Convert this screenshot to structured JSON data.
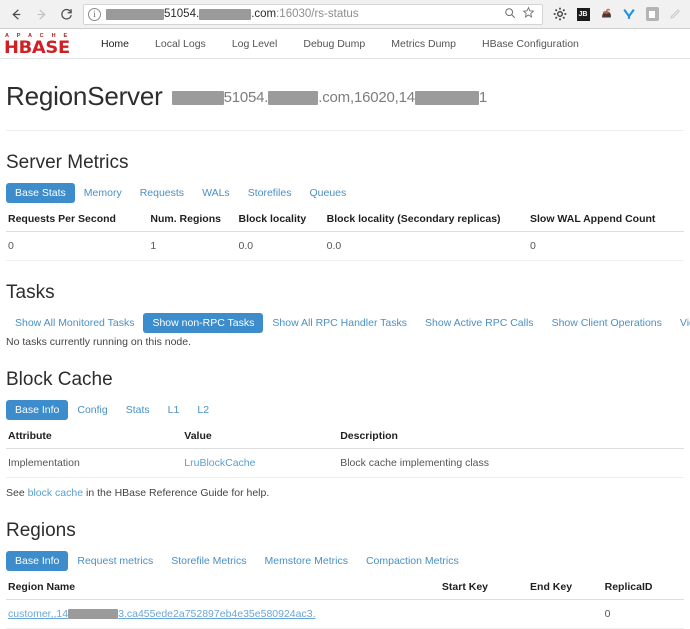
{
  "browser": {
    "back_icon": "back-arrow-icon",
    "forward_icon": "forward-arrow-icon",
    "reload_icon": "reload-icon",
    "url_prefix_redacted": true,
    "url_part1": "51054.",
    "url_part2": ".com",
    "url_part3": ":16030/rs-status",
    "search_icon": "search-icon",
    "bookmark_icon": "star-icon",
    "gear_icon": "gear-icon",
    "jetbrains_icon_label": "JB",
    "extension_icons": [
      "jetbrains-icon",
      "dark-blob-icon",
      "vimeo-y-icon",
      "grey-note-icon",
      "pen-icon"
    ]
  },
  "nav": {
    "logo_top": "A P A C H E",
    "logo_main": "HBASE",
    "links": [
      {
        "label": "Home",
        "active": true
      },
      {
        "label": "Local Logs",
        "active": false
      },
      {
        "label": "Log Level",
        "active": false
      },
      {
        "label": "Debug Dump",
        "active": false
      },
      {
        "label": "Metrics Dump",
        "active": false
      },
      {
        "label": "HBase Configuration",
        "active": false
      }
    ]
  },
  "page": {
    "title": "RegionServer",
    "server_part1": "51054.",
    "server_part2": ".com,16020,14",
    "server_part3": "1"
  },
  "server_metrics": {
    "heading": "Server Metrics",
    "tabs": [
      {
        "label": "Base Stats",
        "active": true
      },
      {
        "label": "Memory",
        "active": false
      },
      {
        "label": "Requests",
        "active": false
      },
      {
        "label": "WALs",
        "active": false
      },
      {
        "label": "Storefiles",
        "active": false
      },
      {
        "label": "Queues",
        "active": false
      }
    ],
    "columns": [
      "Requests Per Second",
      "Num. Regions",
      "Block locality",
      "Block locality (Secondary replicas)",
      "Slow WAL Append Count"
    ],
    "rows": [
      [
        "0",
        "1",
        "0.0",
        "0.0",
        "0"
      ]
    ]
  },
  "tasks": {
    "heading": "Tasks",
    "tabs": [
      {
        "label": "Show All Monitored Tasks",
        "active": false
      },
      {
        "label": "Show non-RPC Tasks",
        "active": true
      },
      {
        "label": "Show All RPC Handler Tasks",
        "active": false
      },
      {
        "label": "Show Active RPC Calls",
        "active": false
      },
      {
        "label": "Show Client Operations",
        "active": false
      },
      {
        "label": "View as JSON",
        "active": false
      }
    ],
    "empty_message": "No tasks currently running on this node."
  },
  "block_cache": {
    "heading": "Block Cache",
    "tabs": [
      {
        "label": "Base Info",
        "active": true
      },
      {
        "label": "Config",
        "active": false
      },
      {
        "label": "Stats",
        "active": false
      },
      {
        "label": "L1",
        "active": false
      },
      {
        "label": "L2",
        "active": false
      }
    ],
    "columns": [
      "Attribute",
      "Value",
      "Description"
    ],
    "rows": [
      {
        "attribute": "Implementation",
        "value": "LruBlockCache",
        "description": "Block cache implementing class"
      }
    ],
    "footnote_prefix": "See ",
    "footnote_link": "block cache",
    "footnote_suffix": " in the HBase Reference Guide for help."
  },
  "regions": {
    "heading": "Regions",
    "tabs": [
      {
        "label": "Base Info",
        "active": true
      },
      {
        "label": "Request metrics",
        "active": false
      },
      {
        "label": "Storefile Metrics",
        "active": false
      },
      {
        "label": "Memstore Metrics",
        "active": false
      },
      {
        "label": "Compaction Metrics",
        "active": false
      }
    ],
    "columns": [
      "Region Name",
      "Start Key",
      "End Key",
      "ReplicaID"
    ],
    "rows": [
      {
        "name_part1": "customer,,14",
        "name_part2": "3.ca455ede2a752897eb4e35e580924ac3.",
        "start_key": "",
        "end_key": "",
        "replica_id": "0"
      }
    ]
  },
  "colors": {
    "accent_blue": "#3d8ccc",
    "link_blue": "#4a90c4",
    "hbase_red": "#cf2026",
    "redaction_grey": "#9a9a9a"
  }
}
